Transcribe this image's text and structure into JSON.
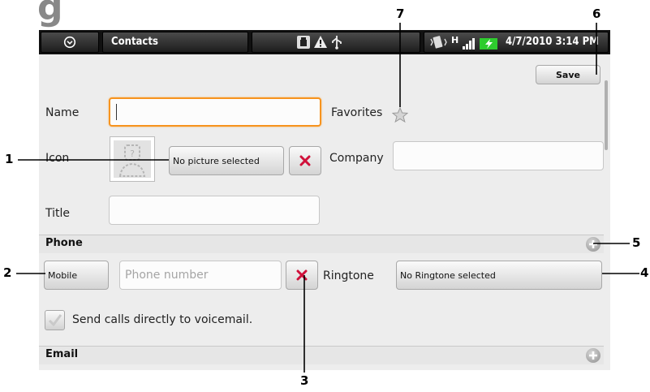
{
  "corner_glyph": "g",
  "status_bar": {
    "app_title": "Contacts",
    "datetime": "4/7/2010 3:14 PM",
    "signal_type": "H"
  },
  "form": {
    "name_label": "Name",
    "name_value": "",
    "favorites_label": "Favorites",
    "icon_label": "Icon",
    "picture_button_label": "No picture selected",
    "company_label": "Company",
    "company_value": "",
    "title_label": "Title",
    "title_value": "",
    "save_label": "Save"
  },
  "phone_section": {
    "title": "Phone",
    "type_button_label": "Mobile",
    "number_placeholder": "Phone number",
    "ringtone_label": "Ringtone",
    "ringtone_button_label": "No Ringtone selected",
    "voicemail_label": "Send calls directly to voicemail."
  },
  "email_section": {
    "title": "Email"
  },
  "callouts": {
    "c1": "1",
    "c2": "2",
    "c3": "3",
    "c4": "4",
    "c5": "5",
    "c6": "6",
    "c7": "7"
  },
  "colors": {
    "focus_border": "#f7931e",
    "delete_x": "#d0103a",
    "battery_green": "#2ecc2e",
    "screen_bg": "#ededed"
  }
}
